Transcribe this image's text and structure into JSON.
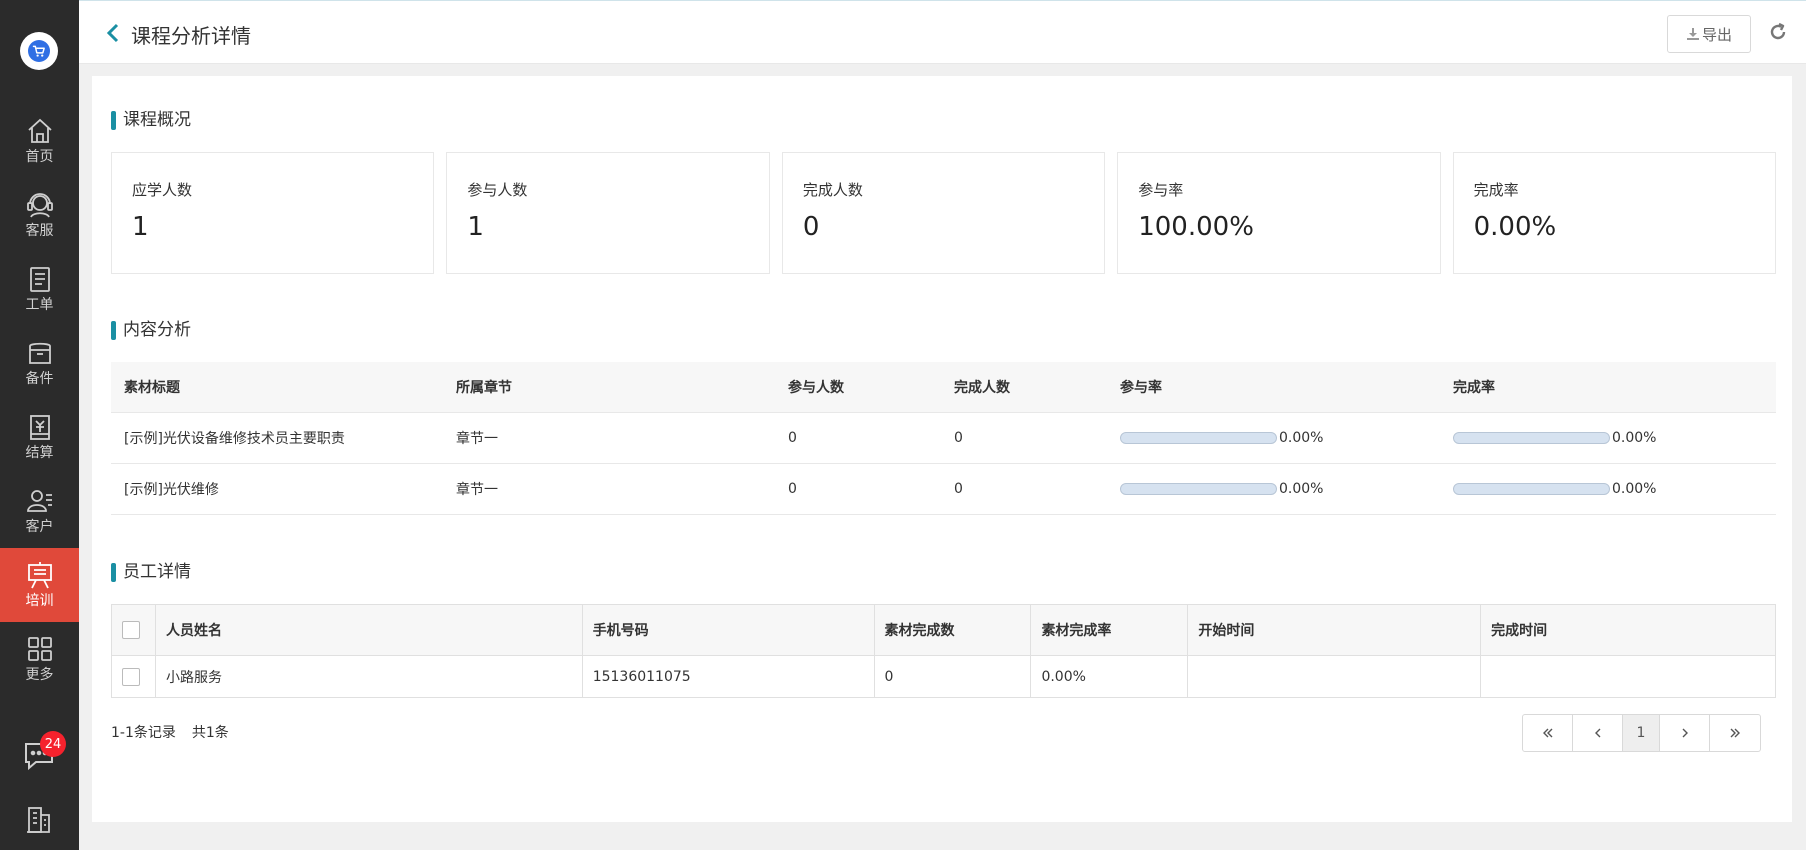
{
  "sidebar": {
    "items": [
      {
        "label": "首页",
        "icon": "home-icon"
      },
      {
        "label": "客服",
        "icon": "headset-icon"
      },
      {
        "label": "工单",
        "icon": "clipboard-icon"
      },
      {
        "label": "备件",
        "icon": "box-icon"
      },
      {
        "label": "结算",
        "icon": "receipt-icon"
      },
      {
        "label": "客户",
        "icon": "users-icon"
      },
      {
        "label": "培训",
        "icon": "training-icon",
        "active": true
      },
      {
        "label": "更多",
        "icon": "grid-icon"
      }
    ],
    "chat_badge": "24"
  },
  "header": {
    "title": "课程分析详情",
    "export_label": "导出"
  },
  "overview": {
    "title": "课程概况",
    "cards": [
      {
        "label": "应学人数",
        "value": "1"
      },
      {
        "label": "参与人数",
        "value": "1"
      },
      {
        "label": "完成人数",
        "value": "0"
      },
      {
        "label": "参与率",
        "value": "100.00%"
      },
      {
        "label": "完成率",
        "value": "0.00%"
      }
    ]
  },
  "content": {
    "title": "内容分析",
    "columns": [
      "素材标题",
      "所属章节",
      "参与人数",
      "完成人数",
      "参与率",
      "完成率"
    ],
    "rows": [
      {
        "title": "[示例]光伏设备维修技术员主要职责",
        "chapter": "章节一",
        "participants": "0",
        "completed": "0",
        "participation_rate": "0.00%",
        "participation_fraction": 0,
        "completion_rate": "0.00%",
        "completion_fraction": 0
      },
      {
        "title": "[示例]光伏维修",
        "chapter": "章节一",
        "participants": "0",
        "completed": "0",
        "participation_rate": "0.00%",
        "participation_fraction": 0,
        "completion_rate": "0.00%",
        "completion_fraction": 0
      }
    ]
  },
  "staff": {
    "title": "员工详情",
    "columns": [
      "人员姓名",
      "手机号码",
      "素材完成数",
      "素材完成率",
      "开始时间",
      "完成时间"
    ],
    "rows": [
      {
        "name": "小路服务",
        "phone": "15136011075",
        "done": "0",
        "rate": "0.00%",
        "start": "",
        "end": ""
      }
    ]
  },
  "pagination": {
    "range_text": "1-1条记录",
    "total_text": "共1条",
    "current_page": "1"
  },
  "colors": {
    "accent": "#1a8fa3",
    "sidebar_bg": "#2b2b2b",
    "active_nav": "#e0493a",
    "badge": "#f5222d"
  }
}
